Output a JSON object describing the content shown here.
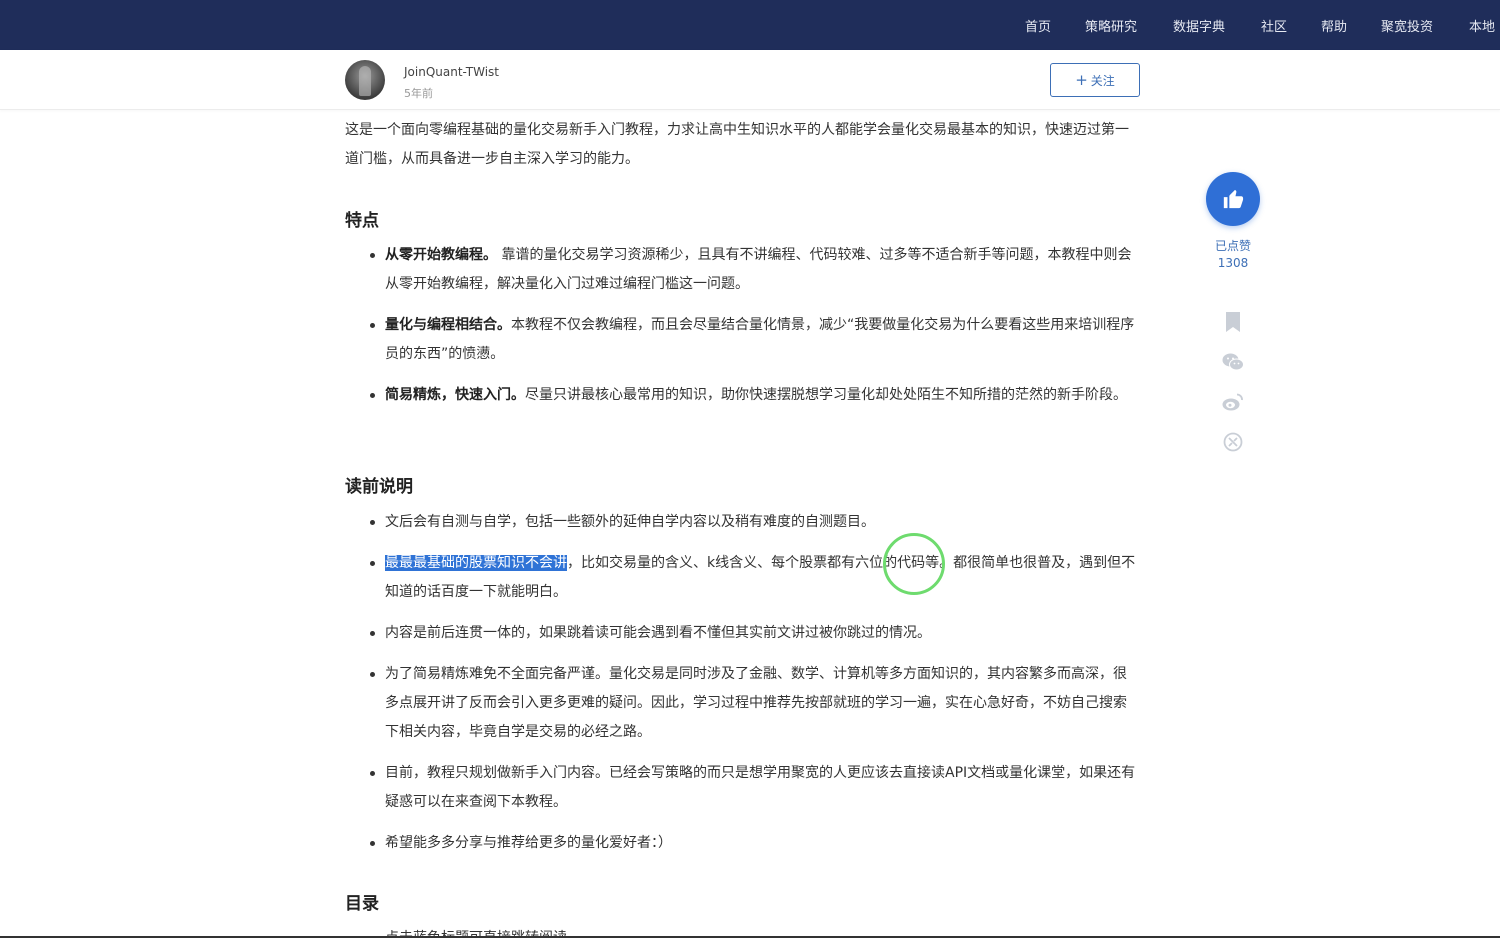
{
  "nav": {
    "items": [
      "首页",
      "策略研究",
      "数据字典",
      "社区",
      "帮助",
      "聚宽投资",
      "本地"
    ]
  },
  "author": {
    "name": "JoinQuant-TWist",
    "time": "5年前",
    "follow_label": "关注"
  },
  "intro": "这是一个面向零编程基础的量化交易新手入门教程，力求让高中生知识水平的人都能学会量化交易最基本的知识，快速迈过第一道门槛，从而具备进一步自主深入学习的能力。",
  "sections": {
    "features": {
      "title": "特点",
      "items": [
        {
          "bold": "从零开始教编程。",
          "text": " 靠谱的量化交易学习资源稀少，且具有不讲编程、代码较难、过多等不适合新手等问题，本教程中则会从零开始教编程，解决量化入门过难过编程门槛这一问题。"
        },
        {
          "bold": "量化与编程相结合。",
          "text": "本教程不仅会教编程，而且会尽量结合量化情景，减少“我要做量化交易为什么要看这些用来培训程序员的东西”的愤懑。"
        },
        {
          "bold": "简易精炼，快速入门。",
          "text": "尽量只讲最核心最常用的知识，助你快速摆脱想学习量化却处处陌生不知所措的茫然的新手阶段。"
        }
      ]
    },
    "notes": {
      "title": "读前说明",
      "items": [
        {
          "highlight": "",
          "text": "文后会有自测与自学，包括一些额外的延伸自学内容以及稍有难度的自测题目。"
        },
        {
          "highlight": "最最最基础的股票知识不会讲",
          "text": "，比如交易量的含义、k线含义、每个股票都有六位的代码等。都很简单也很普及，遇到但不知道的话百度一下就能明白。"
        },
        {
          "highlight": "",
          "text": "内容是前后连贯一体的，如果跳着读可能会遇到看不懂但其实前文讲过被你跳过的情况。"
        },
        {
          "highlight": "",
          "text": "为了简易精炼难免不全面完备严谨。量化交易是同时涉及了金融、数学、计算机等多方面知识的，其内容繁多而高深，很多点展开讲了反而会引入更多更难的疑问。因此，学习过程中推荐先按部就班的学习一遍，实在心急好奇，不妨自己搜索下相关内容，毕竟自学是交易的必经之路。"
        },
        {
          "highlight": "",
          "text": "目前，教程只规划做新手入门内容。已经会写策略的而只是想学用聚宽的人更应该去直接读API文档或量化课堂，如果还有疑惑可以在来查阅下本教程。"
        },
        {
          "highlight": "",
          "text": "希望能多多分享与推荐给更多的量化爱好者：）"
        }
      ]
    },
    "toc": {
      "title": "目录",
      "first_line": "点击蓝色标题可直接跳转阅读"
    }
  },
  "side": {
    "like_label": "已点赞",
    "like_count": "1308",
    "icons": [
      "thumbs-up-icon",
      "bookmark-icon",
      "wechat-icon",
      "weibo-icon",
      "share-icon"
    ],
    "accent": "#2f6fd6"
  },
  "colors": {
    "nav_bg": "#1f2d5a",
    "highlight": "#2f73d6",
    "cursor_ring": "#6edb6e"
  }
}
